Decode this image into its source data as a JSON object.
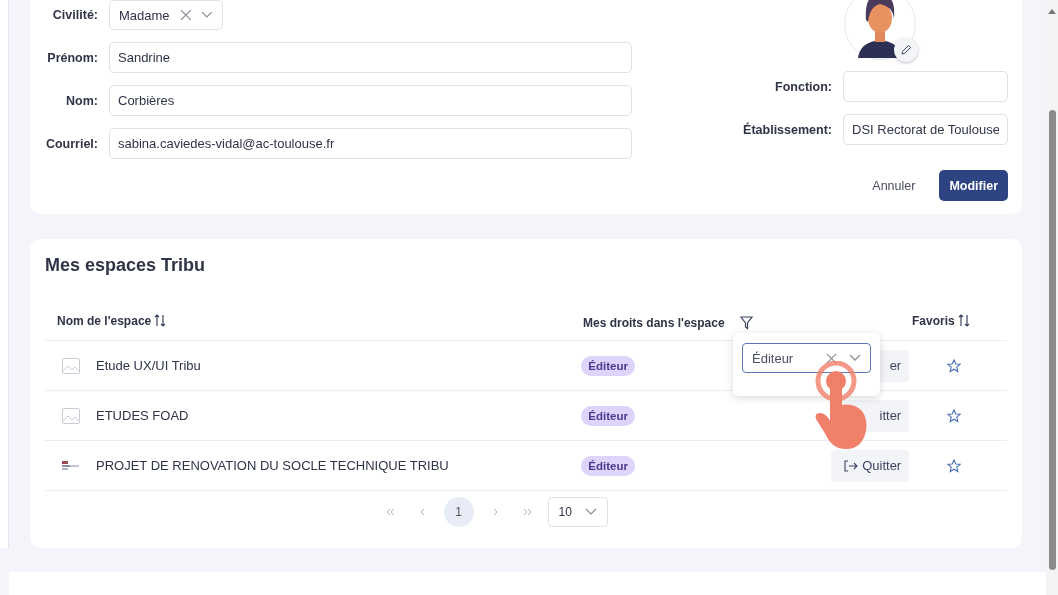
{
  "profile": {
    "fields": [
      {
        "label": "Civilité:",
        "kind": "select",
        "value": "Madame"
      },
      {
        "label": "Prénom:",
        "kind": "text",
        "value": "Sandrine"
      },
      {
        "label": "Nom:",
        "kind": "text",
        "value": "Corbières"
      },
      {
        "label": "Courriel:",
        "kind": "text",
        "value": "sabina.caviedes-vidal@ac-toulouse.fr"
      }
    ],
    "side_fields": [
      {
        "label": "Fonction:"
      },
      {
        "label": "Établissement:",
        "value": "DSI Rectorat de Toulouse"
      }
    ],
    "buttons": [
      {
        "label": "Annuler",
        "kind": "link"
      },
      {
        "label": "Modifier",
        "kind": "primary"
      }
    ]
  },
  "spaces": {
    "title": "Mes espaces Tribu",
    "columns": [
      {
        "label": "Nom de l'espace",
        "sortable": true,
        "filter": false
      },
      {
        "label": "Mes droits dans l'espace",
        "sortable": false,
        "filter": true
      },
      {
        "label": "Favoris",
        "sortable": true,
        "filter": false
      }
    ],
    "rows": [
      {
        "name": "Etude UX/UI Tribu",
        "kind": "placeholder",
        "role": "Éditeur",
        "leave_label": "er",
        "leave_icon": false,
        "favorite": false
      },
      {
        "name": "ETUDES FOAD",
        "kind": "placeholder",
        "role": "Éditeur",
        "leave_label": "itter",
        "leave_icon": false,
        "favorite": false
      },
      {
        "name": "PROJET DE RENOVATION DU SOCLE TECHNIQUE TRIBU",
        "kind": "logo",
        "role": "Éditeur",
        "leave_label": "Quitter",
        "leave_icon": true,
        "favorite": false
      }
    ],
    "filter_popup": {
      "value": "Éditeur"
    },
    "pagination": {
      "pages": [
        {
          "label": "1",
          "selected": true
        }
      ],
      "page_size": "10"
    }
  }
}
